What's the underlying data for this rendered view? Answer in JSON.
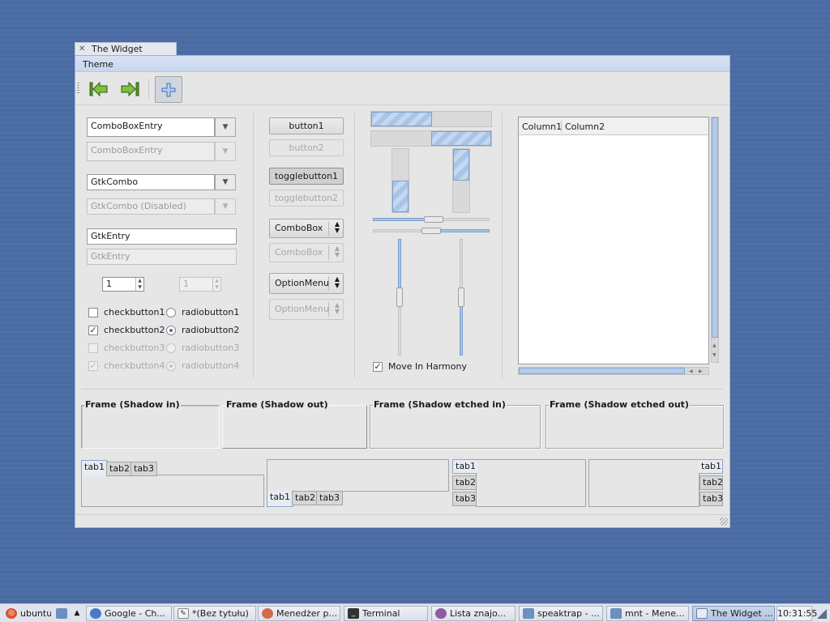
{
  "window": {
    "title": "The Widget Factory",
    "menu": [
      "Theme"
    ]
  },
  "toolbar": {
    "buttons": [
      {
        "name": "go-first",
        "icon": "go-first-icon"
      },
      {
        "name": "go-last",
        "icon": "go-last-icon"
      },
      {
        "name": "add",
        "icon": "add-icon",
        "active": true
      }
    ]
  },
  "left": {
    "comboboxentry": "ComboBoxEntry",
    "comboboxentry_disabled": "ComboBoxEntry",
    "gtkcombo": "GtkCombo",
    "gtkcombo_disabled": "GtkCombo (Disabled)",
    "gtkentry": "GtkEntry",
    "gtkentry_disabled": "GtkEntry",
    "spin1": "1",
    "spin2": "1",
    "checks": [
      {
        "label": "checkbutton1",
        "checked": false,
        "disabled": false
      },
      {
        "label": "checkbutton2",
        "checked": true,
        "disabled": false
      },
      {
        "label": "checkbutton3",
        "checked": false,
        "disabled": true
      },
      {
        "label": "checkbutton4",
        "checked": true,
        "disabled": true
      }
    ],
    "radios": [
      {
        "label": "radiobutton1",
        "selected": false,
        "disabled": false
      },
      {
        "label": "radiobutton2",
        "selected": true,
        "disabled": false
      },
      {
        "label": "radiobutton3",
        "selected": false,
        "disabled": true
      },
      {
        "label": "radiobutton4",
        "selected": true,
        "disabled": true
      }
    ]
  },
  "middle": {
    "button1": "button1",
    "button2": "button2",
    "togglebutton1": "togglebutton1",
    "togglebutton2": "togglebutton2",
    "combobox": "ComboBox",
    "combobox_disabled": "ComboBox",
    "optionmenu": "OptionMenu",
    "optionmenu_disabled": "OptionMenu"
  },
  "progress": {
    "hbar1": 0.5,
    "hbar2": 0.5,
    "vbar1": 0.5,
    "vbar2": 0.5,
    "move_in_harmony": "Move In Harmony"
  },
  "tree": {
    "columns": [
      "Column1",
      "Column2"
    ]
  },
  "frames": [
    {
      "label": "Frame (Shadow in)"
    },
    {
      "label": "Frame (Shadow out)"
    },
    {
      "label": "Frame (Shadow etched in)"
    },
    {
      "label": "Frame (Shadow etched out)"
    }
  ],
  "notebooks": {
    "tabs": [
      "tab1",
      "tab2",
      "tab3"
    ]
  },
  "taskbar": {
    "start": "ubuntu",
    "items": [
      "Google - Ch...",
      "*(Bez tytułu)",
      "Menedżer p...",
      "Terminal",
      "Lista znajo...",
      "speaktrap - ...",
      "mnt - Mene...",
      "The Widget ..."
    ],
    "clock": "10:31:55"
  },
  "colors": {
    "desktop": "#4d6ea6",
    "accent": "#a7c4ea",
    "window_bg": "#e6e6e6"
  }
}
